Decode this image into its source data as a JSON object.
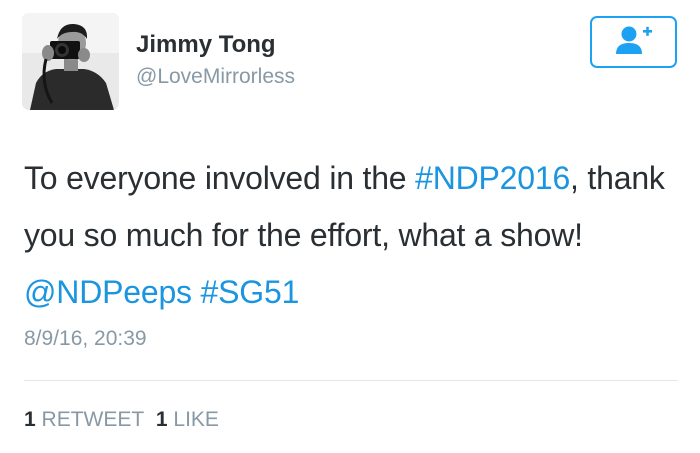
{
  "author": {
    "display_name": "Jimmy Tong",
    "username": "@LoveMirrorless"
  },
  "follow_button": {
    "icon": "add-user-icon",
    "color": "#1da1f2"
  },
  "tweet": {
    "text_part1": "To everyone involved in the ",
    "hashtag1": "#NDP2016",
    "text_part2": ", thank you so much for the effort, what a show! ",
    "mention": "@NDPeeps",
    "text_part3": " ",
    "hashtag2": "#SG51",
    "timestamp": "8/9/16, 20:39"
  },
  "stats": {
    "retweet_count": "1",
    "retweet_label": "RETWEET",
    "like_count": "1",
    "like_label": "LIKE"
  },
  "colors": {
    "link": "#1b95e0",
    "text": "#292f33",
    "muted": "#8899a6",
    "divider": "#e1e8ed"
  }
}
